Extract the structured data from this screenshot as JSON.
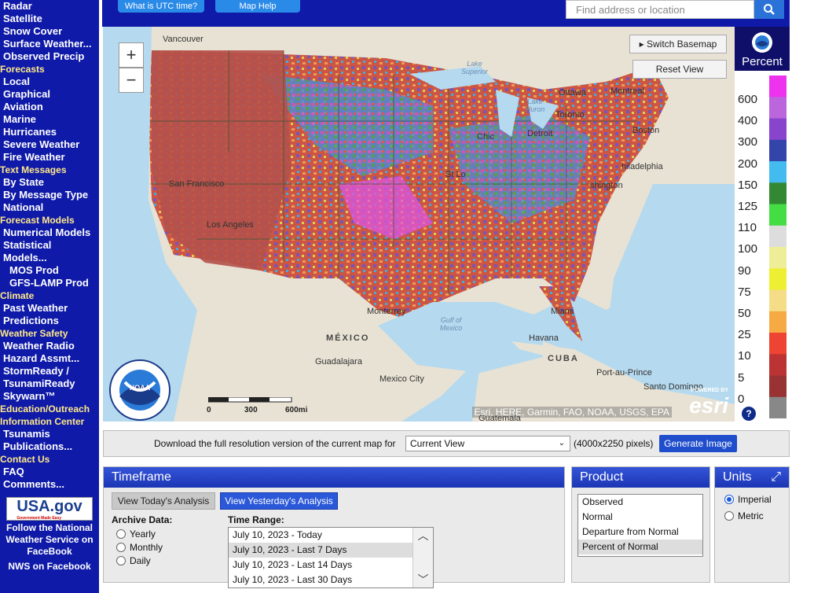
{
  "sidebar": {
    "top_items": [
      "Radar",
      "Satellite",
      "Snow Cover",
      "Surface Weather...",
      "Observed Precip"
    ],
    "sections": [
      {
        "heading": "Forecasts",
        "items": [
          "Local",
          "Graphical",
          "Aviation",
          "Marine",
          "Hurricanes",
          "Severe Weather",
          "Fire Weather"
        ]
      },
      {
        "heading": "Text Messages",
        "items": [
          "By State",
          "By Message Type",
          "National"
        ]
      },
      {
        "heading": "Forecast Models",
        "items": [
          "Numerical Models",
          "Statistical"
        ]
      }
    ],
    "models_label": "Models...",
    "model_subitems": [
      "MOS Prod",
      "GFS-LAMP Prod"
    ],
    "sections2": [
      {
        "heading": "Climate",
        "items": [
          "Past Weather",
          "Predictions"
        ]
      },
      {
        "heading": "Weather Safety",
        "items": [
          "Weather Radio",
          "Hazard Assmt...",
          "StormReady /",
          "TsunamiReady",
          "Skywarn™"
        ]
      }
    ],
    "edu_heading": "Education/Outreach",
    "info_heading": "Information Center",
    "info_items": [
      "Tsunamis",
      "Publications..."
    ],
    "contact_heading": "Contact Us",
    "contact_items": [
      "FAQ",
      "Comments..."
    ],
    "usagov": "USA.gov",
    "usagov_small": "Government Made Easy",
    "follow_text": "Follow the National Weather Service on FaceBook",
    "nws_fb": "NWS on Facebook"
  },
  "header": {
    "utc_button": "What is UTC time?",
    "help_button": "Map Help",
    "search_placeholder": "Find address or location"
  },
  "map": {
    "zoom_in": "+",
    "zoom_out": "−",
    "switch_basemap": "Switch Basemap",
    "reset_view": "Reset View",
    "cities": [
      "Vancouver",
      "Ottawa",
      "Montreal",
      "Toronto",
      "Detroit",
      "Chic",
      "Boston",
      "hiladelphia",
      "shington",
      "San Francisco",
      "Los Angeles",
      "St Lo",
      "Monterrey",
      "Miami",
      "Havana",
      "Guadalajara",
      "Mexico City",
      "Port-au-Prince",
      "Santo Domingo",
      "Guatemala"
    ],
    "countries": [
      "MÉXICO",
      "CUBA"
    ],
    "water": [
      "Lake Superior",
      "Lake Huron",
      "Gulf of Mexico"
    ],
    "attribution": "Esri, HERE, Garmin, FAO, NOAA, USGS, EPA",
    "esri": "esri",
    "powered_by": "POWERED BY",
    "scale": [
      "0",
      "300",
      "600mi"
    ],
    "noaa": "NOAA"
  },
  "legend": {
    "title": "Percent",
    "labels": [
      "600",
      "400",
      "300",
      "200",
      "150",
      "125",
      "110",
      "100",
      "90",
      "75",
      "50",
      "25",
      "10",
      "5",
      "0"
    ],
    "colors": [
      "#ee33ee",
      "#bb66dd",
      "#8844cc",
      "#3344aa",
      "#44bbee",
      "#338833",
      "#44dd44",
      "#dddddd",
      "#eeee99",
      "#eeee33",
      "#f5dd88",
      "#f5aa44",
      "#ee4433",
      "#bb3333",
      "#993333",
      "#888888"
    ]
  },
  "download": {
    "text": "Download the full resolution version of the current map for",
    "select_value": "Current View",
    "size_text": "(4000x2250 pixels)",
    "button": "Generate Image"
  },
  "timeframe": {
    "title": "Timeframe",
    "today_button": "View Today's Analysis",
    "yesterday_button": "View Yesterday's Analysis",
    "archive_label": "Archive Data:",
    "archive_options": [
      "Yearly",
      "Monthly",
      "Daily"
    ],
    "range_label": "Time Range:",
    "range_options": [
      "July 10, 2023 - Today",
      "July 10, 2023 - Last 7 Days",
      "July 10, 2023 - Last 14 Days",
      "July 10, 2023 - Last 30 Days"
    ],
    "range_selected": 1
  },
  "product": {
    "title": "Product",
    "options": [
      "Observed",
      "Normal",
      "Departure from Normal",
      "Percent of Normal"
    ],
    "selected": 3
  },
  "units": {
    "title": "Units",
    "options": [
      "Imperial",
      "Metric"
    ],
    "selected": 0
  }
}
